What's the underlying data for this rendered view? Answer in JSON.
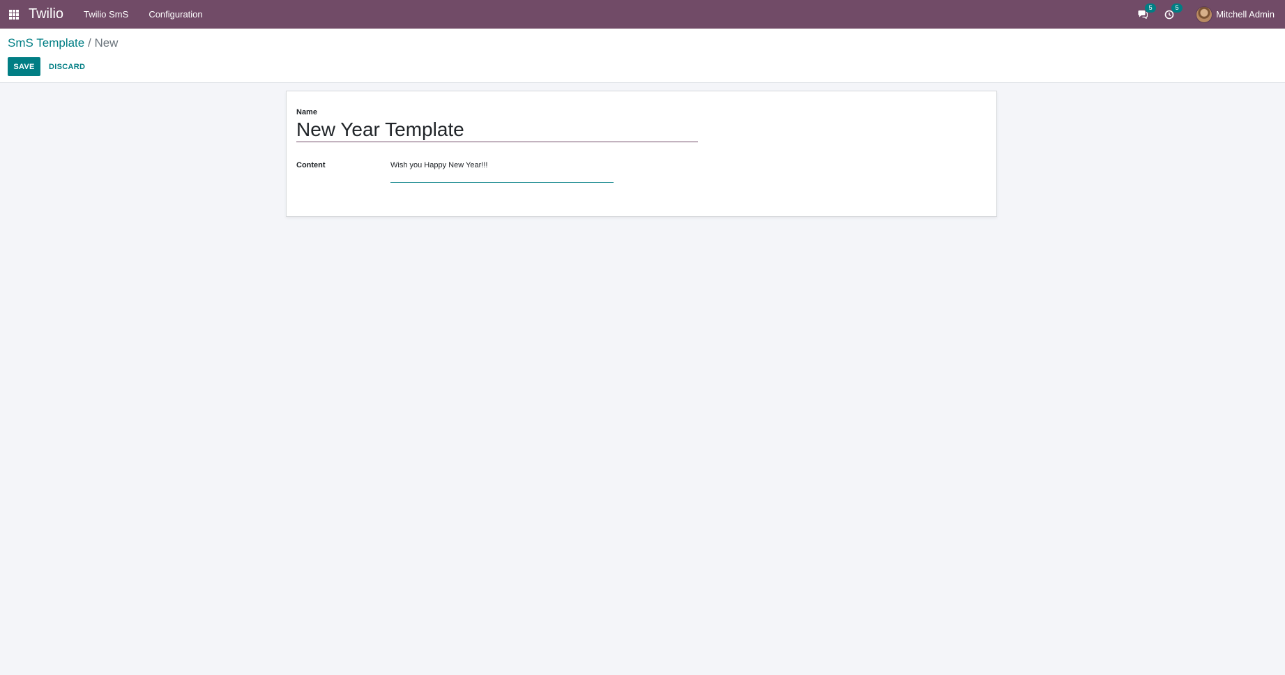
{
  "navbar": {
    "app_name": "Twilio",
    "menu": [
      "Twilio SmS",
      "Configuration"
    ],
    "messages_count": "5",
    "activities_count": "5",
    "user_name": "Mitchell Admin",
    "color": "#714b67"
  },
  "breadcrumb": {
    "parent": "SmS Template",
    "separator": "/",
    "current": "New"
  },
  "actions": {
    "save_label": "SAVE",
    "discard_label": "DISCARD"
  },
  "form": {
    "name_label": "Name",
    "name_value": "New Year Template",
    "content_label": "Content",
    "content_value": "Wish you Happy New Year!!!"
  },
  "colors": {
    "accent": "#017e84",
    "navbar": "#714b67",
    "background": "#f4f5f9"
  }
}
